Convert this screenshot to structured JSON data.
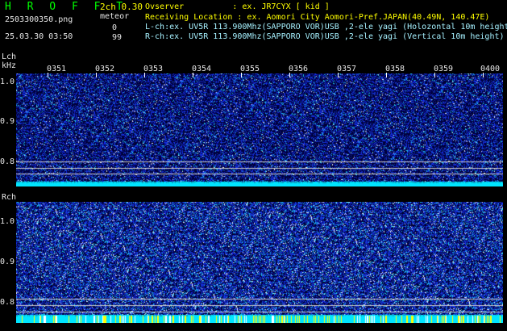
{
  "header": {
    "app_title": "H R O F F T",
    "version": "2ch 0.30",
    "file_name": "2503300350.png",
    "meteor_label": "meteor",
    "meteor_count": "0",
    "meteor_pct": "99",
    "datetime": "25.03.30 03:50",
    "observer": "Ovserver          : ex. JR7CYX [ kid ]",
    "location": "Receiving Location : ex. Aomori City Aomori-Pref.JAPAN(40.49N, 140.47E)",
    "lch_info": "L-ch:ex. UV5R 113.900Mhz(SAPPORO VOR)USB ,2-ele yagi (Holozontal 10m height",
    "rch_info": "R-ch:ex. UV5R 113.900Mhz(SAPPORO VOR)USB ,2-ele yagi (Vertical 10m height)"
  },
  "axes": {
    "lch_label": "Lch",
    "khz_label": "kHz",
    "rch_label": "Rch",
    "time_ticks": [
      "0351",
      "0352",
      "0353",
      "0354",
      "0355",
      "0356",
      "0357",
      "0358",
      "0359",
      "0400"
    ],
    "freq_ticks": [
      "1.0",
      "0.9",
      "0.8"
    ]
  },
  "colors": {
    "background": "#000000",
    "title": "#00ff00",
    "meta": "#ffff00",
    "text": "#e6e6e6",
    "noise_floor": "#00e5ff",
    "meteor_spike": "#ffff00",
    "spectrum_dark": "#000060"
  }
}
